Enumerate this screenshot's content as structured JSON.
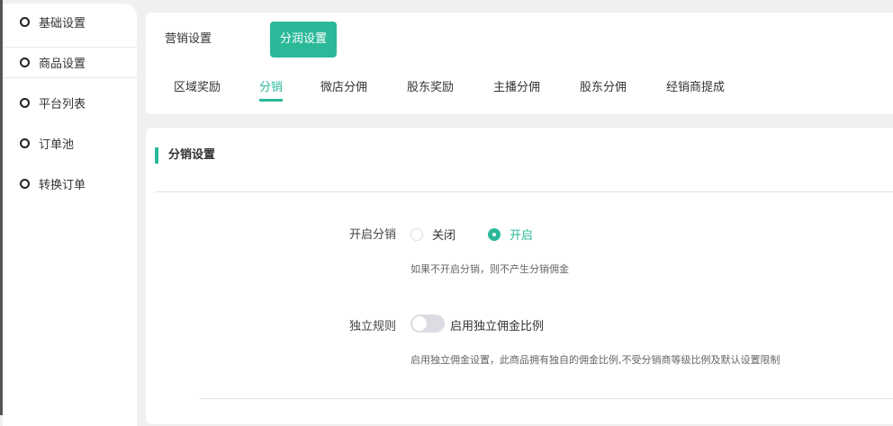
{
  "sidebar": {
    "items": [
      {
        "label": "基础设置"
      },
      {
        "label": "商品设置"
      },
      {
        "label": "平台列表"
      },
      {
        "label": "订单池"
      },
      {
        "label": "转换订单"
      }
    ]
  },
  "top_tabs": [
    {
      "label": "营销设置"
    },
    {
      "label": "分润设置"
    }
  ],
  "sub_tabs": [
    {
      "label": "区域奖励"
    },
    {
      "label": "分销"
    },
    {
      "label": "微店分佣"
    },
    {
      "label": "股东奖励"
    },
    {
      "label": "主播分佣"
    },
    {
      "label": "股东分佣"
    },
    {
      "label": "经销商提成"
    }
  ],
  "section": {
    "title": "分销设置"
  },
  "enable": {
    "label": "开启分销",
    "options": [
      {
        "label": "关闭"
      },
      {
        "label": "开启"
      }
    ],
    "selected": "开启",
    "hint": "如果不开启分销，则不产生分销佣金"
  },
  "independent": {
    "label": "独立规则",
    "switch_label": "启用独立佣金比例",
    "switch_on": false,
    "hint": "启用独立佣金设置，此商品拥有独自的佣金比例,不受分销商等级比例及默认设置限制"
  },
  "colors": {
    "accent": "#2bb99a"
  }
}
